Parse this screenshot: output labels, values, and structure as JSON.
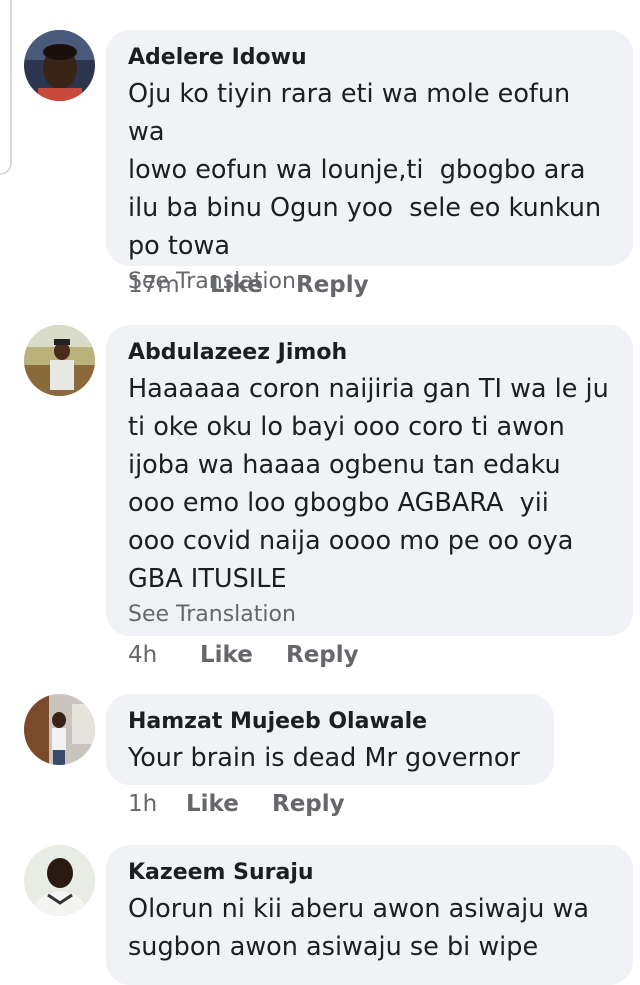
{
  "comments": [
    {
      "author": "Adelere Idowu",
      "text": "Oju ko tiyin rara eti wa mole eofun wa\nlowo eofun wa lounje,ti  gbogbo ara\nilu ba binu Ogun yoo  sele eo kunkun\npo towa",
      "see_translation": "See Translation",
      "time": "17m",
      "like": "Like",
      "reply": "Reply"
    },
    {
      "author": "Abdulazeez Jimoh",
      "text": "Haaaaaa coron naijiria gan TI wa le ju\nti oke oku lo bayi ooo coro ti awon\nijoba wa haaaa ogbenu tan edaku\nooo emo loo gbogbo AGBARA  yii\nooo covid naija oooo mo pe oo oya\nGBA ITUSILE",
      "see_translation": "See Translation",
      "time": "4h",
      "like": "Like",
      "reply": "Reply"
    },
    {
      "author": "Hamzat Mujeeb Olawale",
      "text": "Your brain is dead Mr governor",
      "time": "1h",
      "like": "Like",
      "reply": "Reply"
    },
    {
      "author": "Kazeem Suraju",
      "text": "Olorun ni kii aberu awon asiwaju wa\nsugbon awon asiwaju se bi wipe"
    }
  ]
}
